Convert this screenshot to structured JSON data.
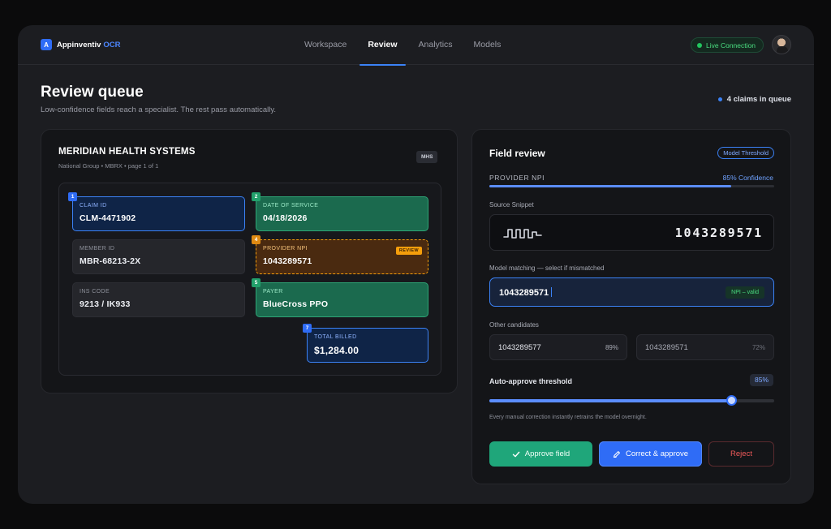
{
  "brand": {
    "mark": "A",
    "name": "Appinventiv",
    "accent": "OCR"
  },
  "nav": {
    "items": [
      "Workspace",
      "Review",
      "Analytics",
      "Models"
    ],
    "active": "Review"
  },
  "status": {
    "label": "Live Connection"
  },
  "header": {
    "title": "Review queue",
    "subtitle": "Low-confidence fields reach a specialist. The rest pass automatically.",
    "queue_count": "4 claims in queue"
  },
  "document": {
    "org": "MERIDIAN HEALTH SYSTEMS",
    "meta": "National Group • MBRX • page 1 of 1",
    "chip": "MHS",
    "fields": [
      {
        "num": "1",
        "label": "CLAIM ID",
        "value": "CLM-4471902",
        "state": "selected"
      },
      {
        "num": "2",
        "label": "DATE OF SERVICE",
        "value": "04/18/2026",
        "state": "approved"
      },
      {
        "num": "",
        "label": "MEMBER ID",
        "value": "MBR-68213-2X",
        "state": "neutral"
      },
      {
        "num": "4",
        "label": "PROVIDER NPI",
        "value": "1043289571",
        "state": "review",
        "tag": "REVIEW"
      },
      {
        "num": "",
        "label": "INS CODE",
        "value": "9213 / IK933",
        "state": "neutral"
      },
      {
        "num": "5",
        "label": "PAYER",
        "value": "BlueCross PPO",
        "state": "approved"
      },
      {
        "num": "7",
        "label": "TOTAL BILLED",
        "value": "$1,284.00",
        "state": "selected"
      }
    ]
  },
  "review": {
    "title": "Field review",
    "chip": "Model Threshold",
    "field_name": "PROVIDER NPI",
    "confidence_label": "85% Confidence",
    "confidence": 0.85,
    "snippet_label": "Source Snippet",
    "snippet_value": "1043289571",
    "match_label": "Model matching — select if mismatched",
    "match_value": "1043289571",
    "match_tag": "NPI – valid",
    "candidates_label": "Other candidates",
    "candidates": [
      {
        "value": "1043289577",
        "pct": "89%"
      },
      {
        "value": "1043289571",
        "pct": "72%"
      }
    ],
    "threshold_label": "Auto-approve threshold",
    "threshold_value": "85%",
    "threshold": 0.85,
    "retrain_note": "Every manual correction instantly retrains the model overnight.",
    "buttons": {
      "approve": "Approve field",
      "correct": "Correct & approve",
      "reject": "Reject"
    }
  },
  "colors": {
    "accent": "#3b82f6",
    "approved": "#1b6a4e",
    "review": "#f59e0b",
    "danger": "#ef5a5a"
  }
}
